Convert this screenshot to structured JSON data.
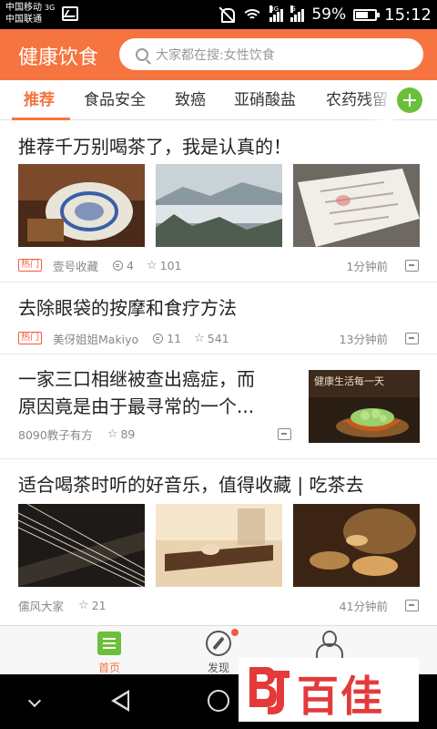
{
  "status_bar": {
    "carrier1": "中国移动",
    "carrier1_net": "3G",
    "carrier2": "中国联通",
    "signal1_label": "3G",
    "signal2_label": "G",
    "battery": "59%",
    "time": "15:12"
  },
  "header": {
    "title": "健康饮食",
    "search_placeholder": "大家都在搜:女性饮食",
    "accent_color": "#f6743f"
  },
  "tabs": [
    {
      "label": "推荐",
      "active": true
    },
    {
      "label": "食品安全",
      "active": false
    },
    {
      "label": "致癌",
      "active": false
    },
    {
      "label": "亚硝酸盐",
      "active": false
    },
    {
      "label": "农药残留",
      "active": false
    }
  ],
  "articles": [
    {
      "title": "推荐千万别喝茶了，我是认真的！",
      "badge": "热门",
      "source": "壹号收藏",
      "comments": "4",
      "stars": "101",
      "time": "1分钟前"
    },
    {
      "title": "去除眼袋的按摩和食疗方法",
      "badge": "热门",
      "source": "美伢姐姐Makiyo",
      "comments": "11",
      "stars": "541",
      "time": "13分钟前"
    },
    {
      "title_line1": "一家三口相继被查出癌症，而",
      "title_line2": "原因竟是由于最寻常的一个...",
      "source": "8090教子有方",
      "stars": "89",
      "thumb_caption": "健康生活每一天"
    },
    {
      "title": "适合喝茶时听的好音乐，值得收藏 | 吃茶去",
      "source": "儒风大家",
      "stars": "21",
      "time": "41分钟前"
    }
  ],
  "bottom_nav": [
    {
      "label": "首页",
      "active": true
    },
    {
      "label": "发现",
      "active": false
    },
    {
      "label": "我的",
      "active": false
    }
  ],
  "watermark": {
    "text": "百佳",
    "logo": "BJ"
  }
}
